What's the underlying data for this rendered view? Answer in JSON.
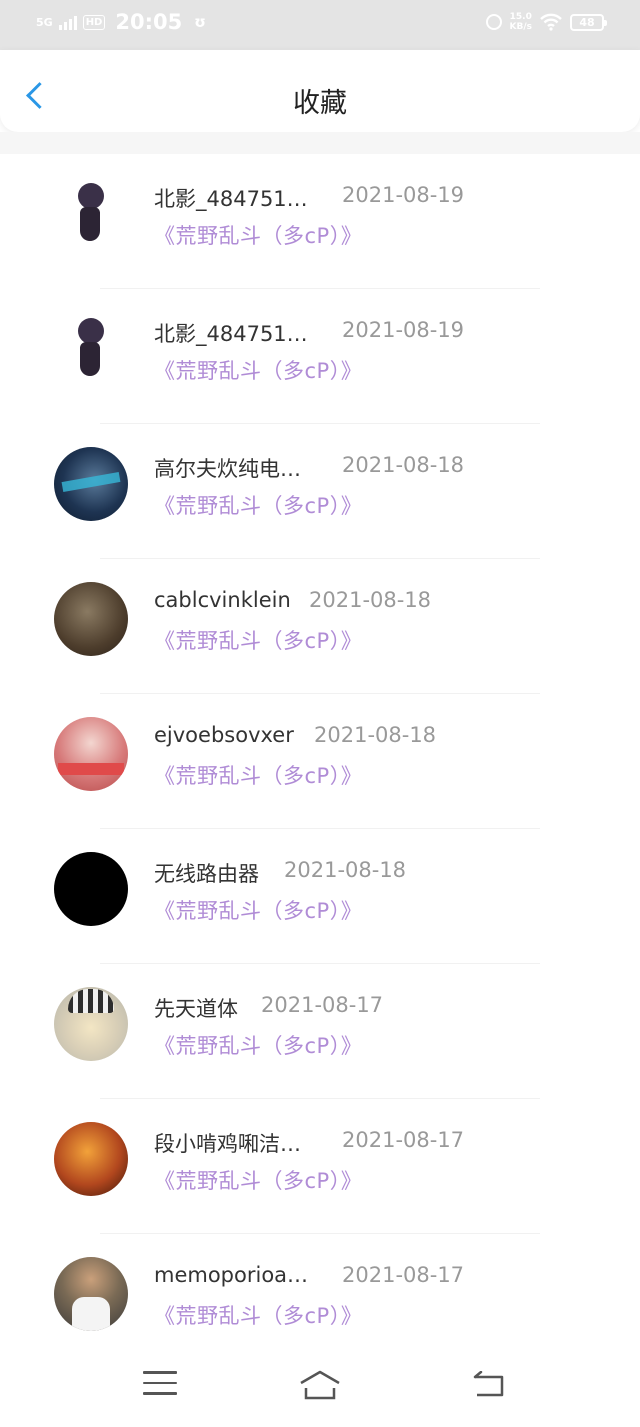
{
  "status_bar": {
    "network": "5G",
    "hd": "HD",
    "time": "20:05",
    "app_icon": "ʊ",
    "speed_value": "15.0",
    "speed_unit": "KB/s",
    "wifi_icon": "wifi-icon",
    "battery": "48"
  },
  "header": {
    "back_icon": "chevron-left-icon",
    "title": "收藏"
  },
  "list": [
    {
      "avatar": "av-chibi",
      "name": "北影_484751…",
      "date": "2021-08-19",
      "work": "《荒野乱斗（多cP）》"
    },
    {
      "avatar": "av-chibi",
      "name": "北影_484751…",
      "date": "2021-08-19",
      "work": "《荒野乱斗（多cP）》"
    },
    {
      "avatar": "av-blue",
      "name": "高尔夫炊纯电…",
      "date": "2021-08-18",
      "work": "《荒野乱斗（多cP）》"
    },
    {
      "avatar": "av-brown",
      "name": "cablcvinklein",
      "date": "2021-08-18",
      "work": "《荒野乱斗（多cP）》"
    },
    {
      "avatar": "av-pink",
      "name": "ejvoebsovxer",
      "date": "2021-08-18",
      "work": "《荒野乱斗（多cP）》"
    },
    {
      "avatar": "av-black",
      "name": "无线路由器",
      "date": "2021-08-18",
      "work": "《荒野乱斗（多cP）》"
    },
    {
      "avatar": "av-anime",
      "name": "先天道体",
      "date": "2021-08-17",
      "work": "《荒野乱斗（多cP）》"
    },
    {
      "avatar": "av-fire",
      "name": "段小啃鸡啝洁…",
      "date": "2021-08-17",
      "work": "《荒野乱斗（多cP）》"
    },
    {
      "avatar": "av-man",
      "name": "memoporioa…",
      "date": "2021-08-17",
      "work": "《荒野乱斗（多cP）》"
    }
  ],
  "nav_bar": {
    "menu_icon": "menu-icon",
    "home_icon": "home-icon",
    "back_icon": "back-icon"
  },
  "colors": {
    "accent": "#2a97e6",
    "work_title": "#b08cd6",
    "status_bar_bg": "#e4e4e4"
  }
}
